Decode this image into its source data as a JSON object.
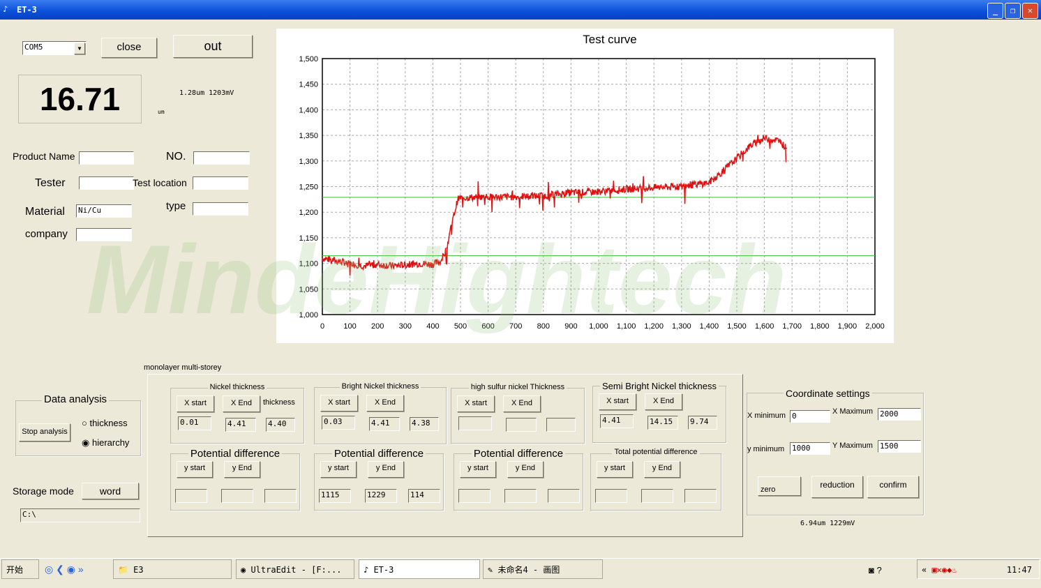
{
  "window": {
    "title": "ET-3",
    "min": "_",
    "max": "❐",
    "close": "✕"
  },
  "top": {
    "port": "COM5",
    "close_label": "close",
    "out_label": "out",
    "reading": "16.71",
    "unit": "um",
    "cursor_readout": "1.28um 1203mV"
  },
  "form": {
    "product_name": {
      "label": "Product Name",
      "value": ""
    },
    "no": {
      "label": "NO.",
      "value": ""
    },
    "tester": {
      "label": "Tester",
      "value": ""
    },
    "test_location": {
      "label": "Test location",
      "value": ""
    },
    "material": {
      "label": "Material",
      "value": "Ni/Cu"
    },
    "type": {
      "label": "type",
      "value": ""
    },
    "company": {
      "label": "company",
      "value": ""
    }
  },
  "watermark": "MindeHightech",
  "analysis": {
    "title": "Data analysis",
    "stop": "Stop analysis",
    "options": [
      "thickness",
      "hierarchy"
    ],
    "selected": "hierarchy"
  },
  "storage": {
    "label": "Storage mode",
    "button": "word",
    "path": "C:\\"
  },
  "mode_tabs": "monolayer multi-storey",
  "groups": [
    {
      "title": "Nickel thickness",
      "xs": "X start",
      "xe": "X End",
      "extra": "thickness",
      "v": [
        "0.01",
        "4.41",
        "4.40"
      ],
      "ptitle": "Potential difference",
      "ys": "y start",
      "ye": "y End",
      "pv": [
        "",
        "",
        ""
      ]
    },
    {
      "title": "Bright Nickel thickness",
      "xs": "X start",
      "xe": "X End",
      "extra": "",
      "v": [
        "0.03",
        "4.41",
        "4.38"
      ],
      "ptitle": "Potential difference",
      "ys": "y start",
      "ye": "y End",
      "pv": [
        "1115",
        "1229",
        "114"
      ]
    },
    {
      "title": "high sulfur nickel Thickness",
      "xs": "X start",
      "xe": "X End",
      "extra": "",
      "v": [
        "",
        "",
        ""
      ],
      "ptitle": "Potential difference",
      "ys": "y start",
      "ye": "y End",
      "pv": [
        "",
        "",
        ""
      ]
    },
    {
      "title": "Semi Bright Nickel thickness",
      "xs": "X start",
      "xe": "X End",
      "extra": "",
      "v": [
        "4.41",
        "14.15",
        "9.74"
      ],
      "ptitle": "Total potential difference",
      "ys": "y start",
      "ye": "y End",
      "pv": [
        "",
        "",
        ""
      ]
    }
  ],
  "coords": {
    "title": "Coordinate settings",
    "xmin_label": "X minimum",
    "xmin": "0",
    "xmax_label": "X Maximum",
    "xmax": "2000",
    "ymin_label": "y minimum",
    "ymin": "1000",
    "ymax_label": "Y Maximum",
    "ymax": "1500",
    "zero": "zero",
    "reduction": "reduction",
    "confirm": "confirm",
    "readout": "6.94um 1229mV"
  },
  "taskbar": {
    "start": "开始",
    "items": [
      "E3",
      "UltraEdit - [F:...",
      "ET-3",
      "未命名4 - 画图"
    ],
    "clock": "11:47"
  },
  "chart_data": {
    "type": "line",
    "title": "Test curve",
    "xlim": [
      0,
      2000
    ],
    "ylim": [
      1000,
      1500
    ],
    "grid": true,
    "xticks": [
      "0",
      "100",
      "200",
      "300",
      "400",
      "500",
      "600",
      "700",
      "800",
      "900",
      "1,000",
      "1,100",
      "1,200",
      "1,300",
      "1,400",
      "1,500",
      "1,600",
      "1,700",
      "1,800",
      "1,900",
      "2,000"
    ],
    "yticks": [
      "1,000",
      "1,050",
      "1,100",
      "1,150",
      "1,200",
      "1,250",
      "1,300",
      "1,350",
      "1,400",
      "1,450",
      "1,500"
    ],
    "hlines": [
      1229,
      1115
    ],
    "colors": {
      "curve": "#e01010",
      "hlines": "#30c030"
    },
    "series": [
      {
        "x": [
          0,
          50,
          100,
          150,
          200,
          250,
          300,
          350,
          400,
          430,
          450,
          470,
          490,
          500,
          600,
          700,
          800,
          900,
          1000,
          1100,
          1200,
          1300,
          1400,
          1450,
          1500,
          1550,
          1600,
          1650,
          1680
        ],
        "y": [
          1110,
          1105,
          1100,
          1095,
          1098,
          1095,
          1097,
          1100,
          1098,
          1105,
          1130,
          1180,
          1225,
          1228,
          1230,
          1230,
          1232,
          1238,
          1240,
          1245,
          1248,
          1250,
          1258,
          1280,
          1305,
          1330,
          1345,
          1340,
          1325
        ]
      }
    ]
  }
}
